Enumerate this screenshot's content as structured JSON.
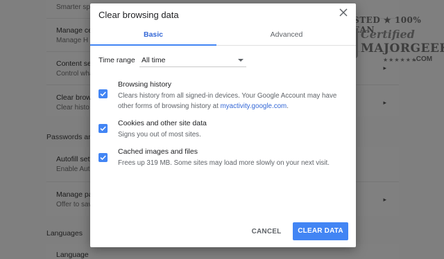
{
  "background": {
    "rows": [
      {
        "title": "",
        "subtitle": "Smarter sp"
      },
      {
        "title": "Manage ce",
        "subtitle": "Manage H"
      },
      {
        "title": "Content se",
        "subtitle": "Control wha"
      },
      {
        "title": "Clear brows",
        "subtitle": "Clear histo"
      }
    ],
    "sections": {
      "passwords": "Passwords and",
      "languages": "Languages"
    },
    "rows2": [
      {
        "title": "Autofill sett",
        "subtitle": "Enable Aut"
      },
      {
        "title": "Manage pa",
        "subtitle": "Offer to sav"
      }
    ],
    "last_row": "Language"
  },
  "watermark": {
    "line1": "TESTED ★ 100% CLEAN",
    "line2": "Certified",
    "line3": "MAJORGEEKS",
    "stars": "★★★★★★",
    "suffix": ".COM"
  },
  "dialog": {
    "title": "Clear browsing data",
    "close_icon": "close-icon",
    "tabs": [
      {
        "label": "Basic",
        "active": true
      },
      {
        "label": "Advanced",
        "active": false
      }
    ],
    "time_range": {
      "label": "Time range",
      "value": "All time"
    },
    "options": [
      {
        "title": "Browsing history",
        "description": "Clears history from all signed-in devices. Your Google Account may have other forms of browsing history at ",
        "link": "myactivity.google.com",
        "description_end": ".",
        "checked": true
      },
      {
        "title": "Cookies and other site data",
        "description": "Signs you out of most sites.",
        "checked": true
      },
      {
        "title": "Cached images and files",
        "description": "Frees up 319 MB. Some sites may load more slowly on your next visit.",
        "checked": true
      }
    ],
    "cancel_label": "CANCEL",
    "clear_label": "CLEAR DATA"
  },
  "colors": {
    "accent": "#4285f4",
    "link": "#3367d6",
    "overlay": "#7f7f7f"
  }
}
